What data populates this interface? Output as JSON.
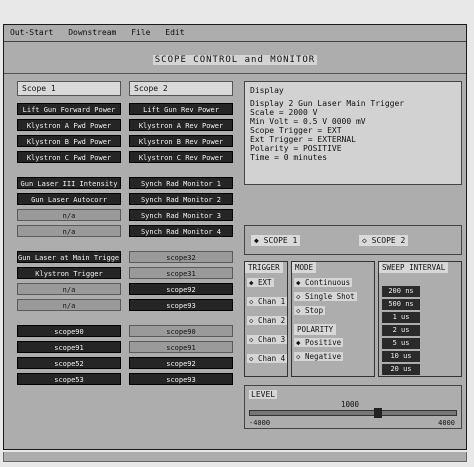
{
  "menu": [
    "Out-Start",
    "Downstream",
    "File",
    "Edit"
  ],
  "title": "SCOPE CONTROL and MONITOR",
  "scope1": {
    "header": "Scope 1",
    "buttons": [
      "Lift Gun Forward Power",
      "Klystron A Fwd Power",
      "Klystron B Fwd Power",
      "Klystron C Fwd Power",
      "Gun Laser III Intensity",
      "Gun Laser Autocorr",
      "n/a",
      "n/a",
      "Gun Laser at Main Trigger",
      "Klystron Trigger",
      "n/a",
      "n/a",
      "scope90",
      "scope91",
      "scope52",
      "scope53"
    ]
  },
  "scope2": {
    "header": "Scope 2",
    "buttons": [
      "Lift Gun Rev Power",
      "Klystron A Rev Power",
      "Klystron B Rev Power",
      "Klystron C Rev Power",
      "Synch Rad Monitor 1",
      "Synch Rad Monitor 2",
      "Synch Rad Monitor 3",
      "Synch Rad Monitor 4",
      "scope32",
      "scope31",
      "scope92",
      "scope93",
      "scope90",
      "scope91",
      "scope92",
      "scope93"
    ]
  },
  "display": {
    "label": "Display",
    "lines": [
      "Display 2 Gun Laser Main Trigger",
      "Scale = 2000 V",
      "Min Volt = 0.5 V 0000 mV",
      "Scope Trigger = EXT",
      "Ext Trigger = EXTERNAL",
      "Polarity = POSITIVE",
      "Time = 0 minutes"
    ]
  },
  "scope_select": {
    "option1": "SCOPE 1",
    "option2": "SCOPE 2"
  },
  "trigger": {
    "title": "TRIGGER",
    "options": [
      "EXT",
      "Chan 1",
      "Chan 2",
      "Chan 3",
      "Chan 4"
    ]
  },
  "mode": {
    "title": "MODE",
    "options": [
      "Continuous",
      "Single Shot",
      "Stop"
    ],
    "polarity_title": "POLARITY",
    "polarity_options": [
      "Positive",
      "Negative"
    ]
  },
  "sweep": {
    "title": "SWEEP INTERVAL",
    "values": [
      "200 ns",
      "500 ns",
      "1 us",
      "2 us",
      "5 us",
      "10 us",
      "20 us"
    ]
  },
  "level": {
    "label": "LEVEL",
    "value": "1000",
    "min": "-4000",
    "max": "4000"
  }
}
